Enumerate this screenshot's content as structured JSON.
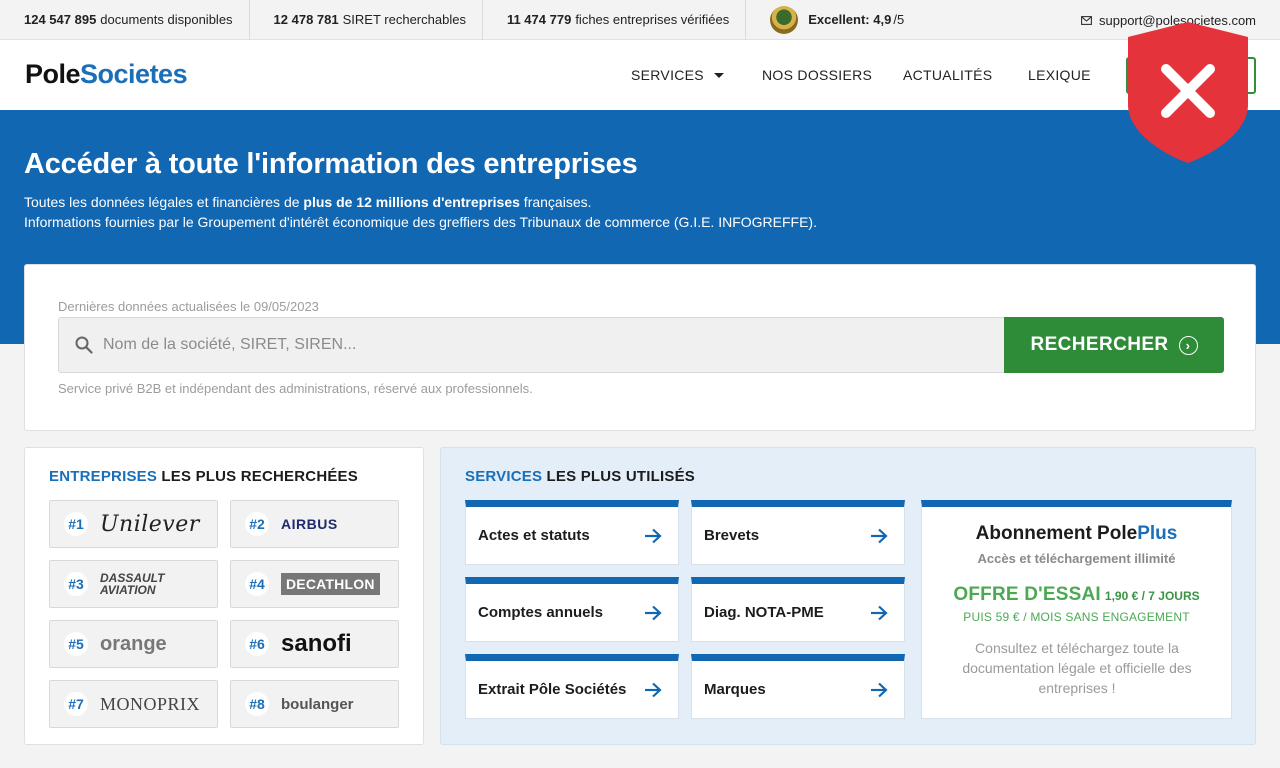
{
  "topbar": {
    "stats": [
      {
        "value": "124 547 895",
        "label": "documents disponibles"
      },
      {
        "value": "12 478 781",
        "label": "SIRET recherchables"
      },
      {
        "value": "11 474 779",
        "label": "fiches entreprises vérifiées"
      }
    ],
    "rating_label": "Excellent: 4,9",
    "rating_suffix": "/5",
    "support_email": "support@polesocietes.com"
  },
  "header": {
    "logo_part1": "Pole",
    "logo_part2": "Societes",
    "nav": [
      "SERVICES",
      "NOS DOSSIERS",
      "ACTUALITÉS",
      "LEXIQUE"
    ]
  },
  "hero": {
    "title": "Accéder à toute l'information des entreprises",
    "line1_pre": "Toutes les données légales et financières de ",
    "line1_bold": "plus de 12 millions d'entreprises",
    "line1_post": " françaises.",
    "line2": "Informations fournies par le Groupement d'intérêt économique des greffiers des Tribunaux de commerce (G.I.E. INFOGREFFE)."
  },
  "search": {
    "updated": "Dernières données actualisées le 09/05/2023",
    "placeholder": "Nom de la société, SIRET, SIREN...",
    "button": "RECHERCHER",
    "disclaimer": "Service privé B2B et indépendant des administrations, réservé aux professionnels."
  },
  "companies": {
    "title_highlight": "ENTREPRISES",
    "title_rest": " LES PLUS RECHERCHÉES",
    "items": [
      {
        "rank": "#1",
        "name": "Unilever"
      },
      {
        "rank": "#2",
        "name": "AIRBUS"
      },
      {
        "rank": "#3",
        "name": "DASSAULT AVIATION"
      },
      {
        "rank": "#4",
        "name": "DECATHLON"
      },
      {
        "rank": "#5",
        "name": "orange"
      },
      {
        "rank": "#6",
        "name": "sanofi"
      },
      {
        "rank": "#7",
        "name": "MONOPRIX"
      },
      {
        "rank": "#8",
        "name": "boulanger"
      }
    ]
  },
  "services": {
    "title_highlight": "SERVICES",
    "title_rest": " LES PLUS UTILISÉS",
    "items": [
      "Actes et statuts",
      "Brevets",
      "Comptes annuels",
      "Diag. NOTA-PME",
      "Extrait Pôle Sociétés",
      "Marques"
    ],
    "poleplus": {
      "title": "Abonnement Pole",
      "title_accent": "Plus",
      "subtitle": "Accès et téléchargement illimité",
      "offer": "OFFRE D'ESSAI",
      "offer_price": "1,90 € / 7 JOURS",
      "then": "PUIS 59 € / MOIS SANS ENGAGEMENT",
      "description": "Consultez et téléchargez toute la documentation légale et officielle des entreprises !"
    }
  },
  "colors": {
    "brand_blue": "#1167b1",
    "accent_green": "#2e8b38",
    "badge_red": "#e5333b"
  },
  "icons": {
    "email": "envelope-icon",
    "search": "magnifier-icon",
    "arrow": "arrow-right-icon",
    "shield": "shield-x-icon"
  }
}
